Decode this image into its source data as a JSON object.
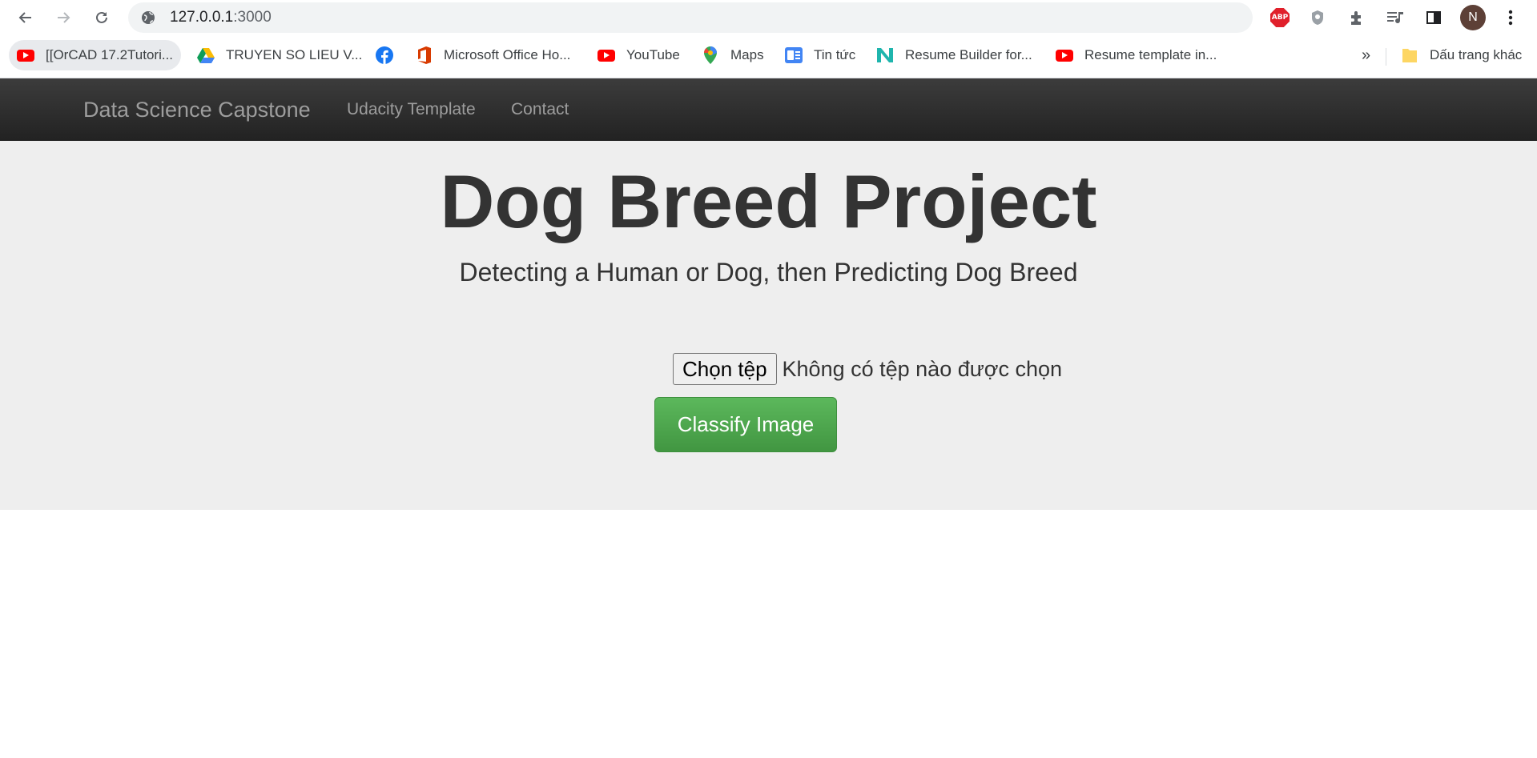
{
  "browser": {
    "url_host": "127.0.0.1",
    "url_port": ":3000",
    "profile_initial": "N",
    "bookmarks": [
      {
        "label": "[[OrCAD 17.2Tutori...",
        "icon": "youtube-icon"
      },
      {
        "label": "TRUYEN SO LIEU V...",
        "icon": "google-drive-icon"
      },
      {
        "label": "",
        "icon": "facebook-icon"
      },
      {
        "label": "Microsoft Office Ho...",
        "icon": "office-icon"
      },
      {
        "label": "YouTube",
        "icon": "youtube-icon"
      },
      {
        "label": "Maps",
        "icon": "maps-icon"
      },
      {
        "label": "Tin tức",
        "icon": "google-news-icon"
      },
      {
        "label": "Resume Builder for...",
        "icon": "novoresume-icon"
      },
      {
        "label": "Resume template in...",
        "icon": "youtube-icon"
      }
    ],
    "more_bookmarks": "»",
    "other_bookmarks": "Dấu trang khác"
  },
  "navbar": {
    "brand": "Data Science Capstone",
    "links": [
      "Udacity Template",
      "Contact"
    ]
  },
  "main": {
    "title": "Dog Breed Project",
    "subtitle": "Detecting a Human or Dog, then Predicting Dog Breed",
    "file_button": "Chọn tệp",
    "file_status": "Không có tệp nào được chọn",
    "classify_button": "Classify Image"
  },
  "colors": {
    "navbar_bg": "#222222",
    "jumbotron_bg": "#eeeeee",
    "success": "#5cb85c"
  }
}
